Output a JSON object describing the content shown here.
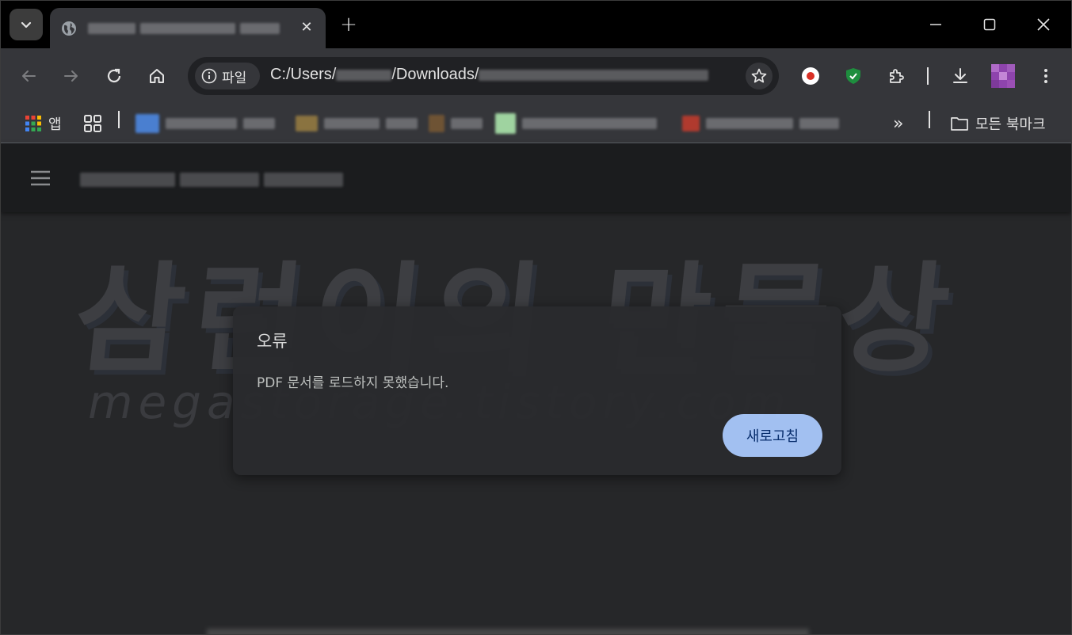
{
  "tab": {
    "close_glyph": "✕"
  },
  "new_tab_glyph": "+",
  "omnibox": {
    "chip_label": "파일",
    "url_prefix": "C:/Users/",
    "url_mid": "/Downloads/"
  },
  "bookmarks": {
    "apps_label": "앱",
    "more_glyph": "»",
    "all_bookmarks_label": "모든 북마크"
  },
  "watermark": {
    "main": "삼런이의 만물상",
    "sub": "megastorage.tistory.com"
  },
  "dialog": {
    "title": "오류",
    "message": "PDF 문서를 로드하지 못했습니다.",
    "reload_label": "새로고침"
  },
  "colors": {
    "accent": "#a8c7fa",
    "toolbar": "#35363a",
    "tabstrip": "#000000",
    "content_bg": "#262729"
  }
}
